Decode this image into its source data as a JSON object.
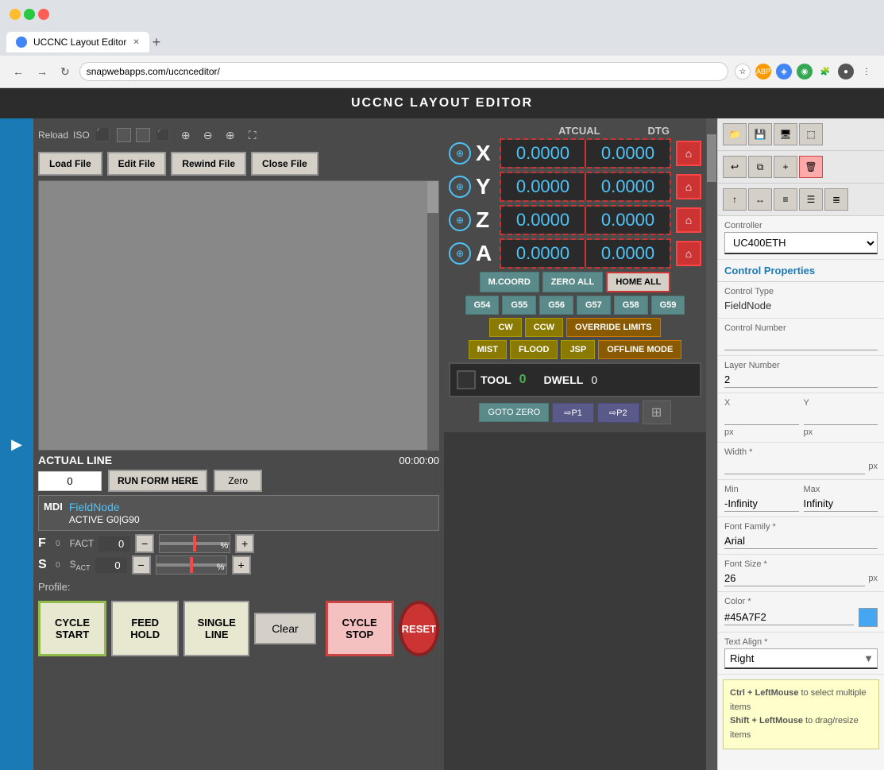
{
  "browser": {
    "tab_title": "UCCNC Layout Editor",
    "url": "snapwebapps.com/uccnceditor/",
    "new_tab_label": "+"
  },
  "app": {
    "title": "UCCNC LAYOUT EDITOR"
  },
  "toolbar": {
    "reload": "Reload",
    "mode": "ISO"
  },
  "file_buttons": {
    "load": "Load File",
    "edit": "Edit File",
    "rewind": "Rewind File",
    "close": "Close File"
  },
  "axis": {
    "atcual_label": "ATCUAL",
    "dtg_label": "DTG",
    "rows": [
      {
        "letter": "X",
        "atcual": "0.0000",
        "dtg": "0.0000"
      },
      {
        "letter": "Y",
        "atcual": "0.0000",
        "dtg": "0.0000"
      },
      {
        "letter": "Z",
        "atcual": "0.0000",
        "dtg": "0.0000"
      },
      {
        "letter": "A",
        "atcual": "0.0000",
        "dtg": "0.0000"
      }
    ]
  },
  "coord_buttons": {
    "mcoord": "M.COORD",
    "zero_all": "ZERO ALL",
    "home_all": "HOME ALL",
    "g54": "G54",
    "g55": "G55",
    "g56": "G56",
    "g57": "G57",
    "g58": "G58",
    "g59": "G59",
    "cw": "CW",
    "ccw": "CCW",
    "override": "OVERRIDE LIMITS",
    "mist": "MIST",
    "flood": "FLOOD",
    "jsp": "JSP",
    "offline": "OFFLINE MODE"
  },
  "nav_buttons": {
    "goto_zero": "GOTO ZERO",
    "p1": "⇨P1",
    "p2": "⇨P2"
  },
  "tool": {
    "tool_label": "TOOL",
    "tool_val": "0",
    "dwell_label": "DWELL",
    "dwell_val": "0"
  },
  "actual_line": {
    "label": "ACTUAL LINE",
    "time": "00:00:00",
    "value": "0",
    "run_btn": "RUN FORM HERE",
    "zero_btn": "Zero"
  },
  "mdi": {
    "label": "MDI",
    "name": "FieldNode",
    "active_label": "ACTIVE",
    "active_val": "G0|G90"
  },
  "f_row": {
    "label": "F",
    "small": "0",
    "fact_label": "FACT",
    "fact_val": "0",
    "percent_label": "%"
  },
  "s_row": {
    "label": "S",
    "small": "0",
    "sact_label": "SACT",
    "sact_val": "0",
    "percent_label": "%"
  },
  "profile": {
    "label": "Profile:"
  },
  "cycle_buttons": {
    "cycle_start": "CYCLE\nSTART",
    "cycle_start_line1": "CYCLE",
    "cycle_start_line2": "START",
    "feed_hold_line1": "FEED",
    "feed_hold_line2": "HOLD",
    "single_line_line1": "SINGLE",
    "single_line_line2": "LINE",
    "clear": "Clear",
    "cycle_stop_line1": "CYCLE",
    "cycle_stop_line2": "STOP",
    "reset": "RESET"
  },
  "right_panel": {
    "controller_label": "Controller",
    "controller_value": "UC400ETH",
    "section_title": "Control Properties",
    "control_type_label": "Control Type",
    "control_type_value": "FieldNode",
    "control_number_label": "Control Number",
    "control_number_value": "",
    "layer_label": "Layer Number",
    "layer_value": "2",
    "x_label": "X",
    "x_value": "",
    "x_unit": "px",
    "y_label": "Y",
    "y_value": "",
    "y_unit": "px",
    "width_label": "Width *",
    "width_value": "",
    "width_unit": "px",
    "min_label": "Min",
    "min_value": "-Infinity",
    "max_label": "Max",
    "max_value": "Infinity",
    "font_family_label": "Font Family *",
    "font_family_value": "Arial",
    "font_size_label": "Font Size *",
    "font_size_value": "26",
    "font_size_unit": "px",
    "color_label": "Color *",
    "color_value": "#45A7F2",
    "text_align_label": "Text Align *",
    "text_align_value": "Right",
    "hint_title": "Ctrl + LeftMouse",
    "hint_text1": "to select multiple items",
    "hint_text2": "Shift + LeftMouse",
    "hint_text3": "to drag/resize items"
  }
}
